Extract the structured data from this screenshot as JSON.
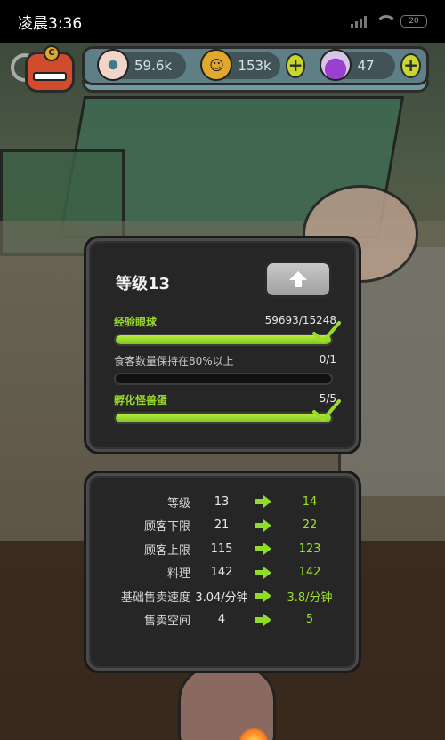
{
  "status_bar": {
    "time": "凌晨3:36",
    "battery": "20"
  },
  "hud": {
    "eyes": "59.6k",
    "coins": "153k",
    "potions": "47"
  },
  "level_panel": {
    "title": "等级13",
    "requirements": [
      {
        "label": "经验眼球",
        "count": "59693/15248",
        "progress": 1.0,
        "complete": true
      },
      {
        "label": "食客数量保持在80%以上",
        "count": "0/1",
        "progress": 0.0,
        "complete": false
      },
      {
        "label": "孵化怪兽蛋",
        "count": "5/5",
        "progress": 1.0,
        "complete": true
      }
    ]
  },
  "stats_panel": {
    "rows": [
      {
        "name": "等级",
        "current": "13",
        "next": "14"
      },
      {
        "name": "顾客下限",
        "current": "21",
        "next": "22"
      },
      {
        "name": "顾客上限",
        "current": "115",
        "next": "123"
      },
      {
        "name": "料理",
        "current": "142",
        "next": "142"
      },
      {
        "name": "基础售卖速度",
        "current": "3.04/分钟",
        "next": "3.8/分钟"
      },
      {
        "name": "售卖空间",
        "current": "4",
        "next": "5"
      }
    ]
  },
  "colors": {
    "accent_green": "#98d82a",
    "panel_bg": "#262626"
  }
}
